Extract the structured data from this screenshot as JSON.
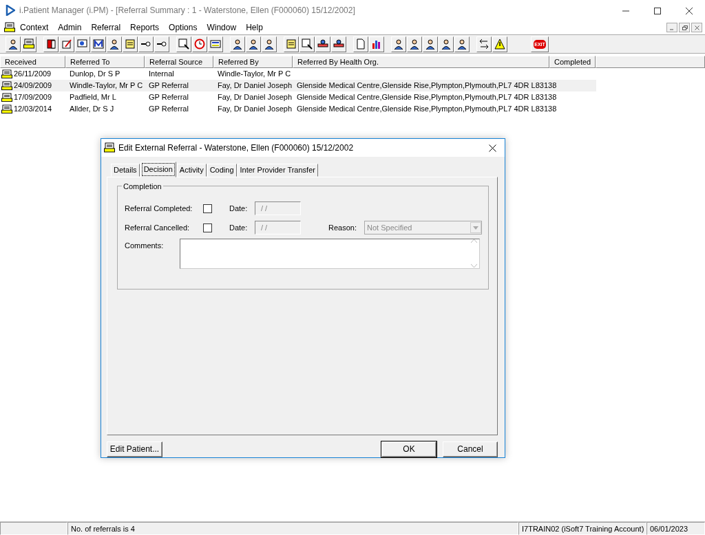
{
  "window": {
    "title": "i.Patient Manager (i.PM) - [Referral Summary : 1 - Waterstone, Ellen (F000060) 15/12/2002]"
  },
  "menu": [
    "Context",
    "Admin",
    "Referral",
    "Reports",
    "Options",
    "Window",
    "Help"
  ],
  "toolbar": {
    "exit_label": "EXIT"
  },
  "table": {
    "columns": [
      "Received",
      "Referred To",
      "Referral Source",
      "Referred By",
      "Referred By Health Org.",
      "Completed"
    ],
    "rows": [
      {
        "selected": false,
        "cells": [
          "26/11/2009",
          "Dunlop, Dr S P",
          "Internal",
          "Windle-Taylor, Mr P C",
          ""
        ]
      },
      {
        "selected": true,
        "cells": [
          "24/09/2009",
          "Windle-Taylor, Mr P C",
          "GP Referral",
          "Fay, Dr Daniel Joseph",
          "Glenside Medical Centre,Glenside Rise,Plympton,Plymouth,PL7 4DR L83138"
        ]
      },
      {
        "selected": false,
        "cells": [
          "17/09/2009",
          "Padfield, Mr L",
          "GP Referral",
          "Fay, Dr Daniel Joseph",
          "Glenside Medical Centre,Glenside Rise,Plympton,Plymouth,PL7 4DR L83138"
        ]
      },
      {
        "selected": false,
        "cells": [
          "12/03/2014",
          "Allder, Dr S J",
          "GP Referral",
          "Fay, Dr Daniel Joseph",
          "Glenside Medical Centre,Glenside Rise,Plympton,Plymouth,PL7 4DR L83138"
        ]
      }
    ]
  },
  "dialog": {
    "title": "Edit External Referral - Waterstone, Ellen (F000060) 15/12/2002",
    "tabs": [
      {
        "label": "Details",
        "selected": false
      },
      {
        "label": "Decision",
        "selected": true
      },
      {
        "label": "Activity",
        "selected": false
      },
      {
        "label": "Coding",
        "selected": false
      },
      {
        "label": "Inter Provider Transfer",
        "selected": false
      }
    ],
    "group_title": "Completion",
    "completed": {
      "label": "Referral Completed:",
      "checked": false,
      "date_label": "Date:",
      "date": "/ /"
    },
    "cancelled": {
      "label": "Referral Cancelled:",
      "checked": false,
      "date_label": "Date:",
      "date": "/ /",
      "reason_label": "Reason:",
      "reason": "Not Specified"
    },
    "comments_label": "Comments:",
    "buttons": {
      "edit_patient": "Edit Patient...",
      "ok": "OK",
      "cancel": "Cancel"
    }
  },
  "status_bar": [
    "No. of referrals is 4",
    "I7TRAIN02 (iSoft7 Training Account)",
    "06/01/2023"
  ]
}
